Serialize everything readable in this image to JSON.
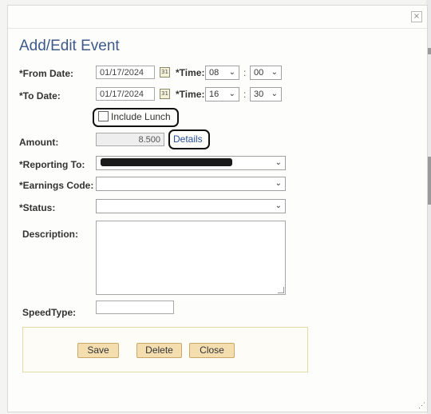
{
  "dialog": {
    "close_glyph": "×",
    "title": "Add/Edit Event"
  },
  "from": {
    "label": "*From Date:",
    "date": "01/17/2024",
    "time_label": "*Time:",
    "hour": "08",
    "minute": "00"
  },
  "to": {
    "label": "*To Date:",
    "date": "01/17/2024",
    "time_label": "*Time:",
    "hour": "16",
    "minute": "30"
  },
  "calendar_glyph": "31",
  "time_separator": ":",
  "dropdown_arrow": "⌄",
  "include_lunch": {
    "label": "Include Lunch",
    "checked": false
  },
  "amount": {
    "label": "Amount:",
    "value": "8.500",
    "details_link": "Details"
  },
  "reporting_to": {
    "label": "*Reporting To:",
    "value": ""
  },
  "earnings_code": {
    "label": "*Earnings Code:",
    "value": ""
  },
  "status": {
    "label": "*Status:",
    "value": ""
  },
  "description": {
    "label": "Description:",
    "value": ""
  },
  "speedtype": {
    "label": "SpeedType:",
    "value": ""
  },
  "buttons": {
    "save": "Save",
    "delete": "Delete",
    "close": "Close"
  },
  "colors": {
    "title": "#3d5a8a",
    "link": "#2a4f9a",
    "button_bg": "#f4deb0",
    "button_border": "#c9a868"
  }
}
